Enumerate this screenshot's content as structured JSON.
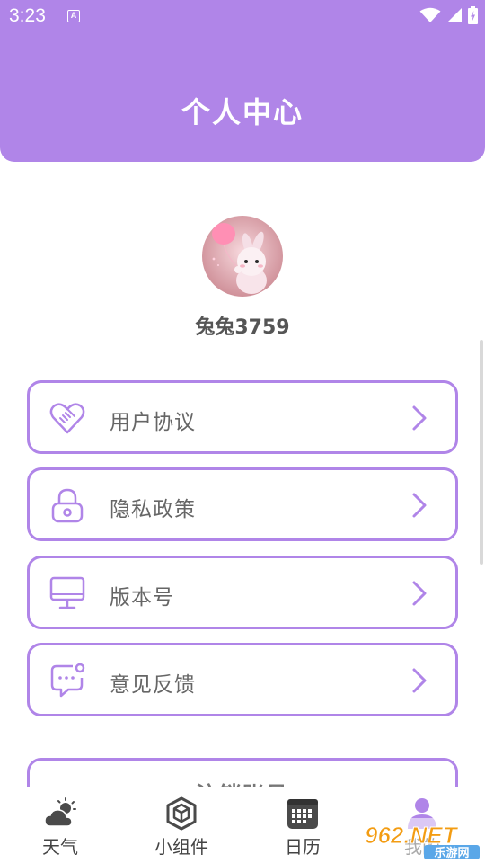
{
  "status_bar": {
    "time": "3:23",
    "notification_badge": "A",
    "icons": [
      "wifi-icon",
      "signal-icon",
      "battery-charging-icon"
    ]
  },
  "header": {
    "title": "个人中心"
  },
  "profile": {
    "avatar": "bunny-with-balloon-avatar",
    "username": "兔兔3759"
  },
  "menu": [
    {
      "icon": "handshake-heart-icon",
      "label": "用户协议"
    },
    {
      "icon": "lock-icon",
      "label": "隐私政策"
    },
    {
      "icon": "monitor-icon",
      "label": "版本号"
    },
    {
      "icon": "chat-bubble-icon",
      "label": "意见反馈"
    }
  ],
  "logout": {
    "label": "注销账号"
  },
  "bottom_nav": [
    {
      "icon": "weather-icon",
      "label": "天气"
    },
    {
      "icon": "widget-cube-icon",
      "label": "小组件"
    },
    {
      "icon": "calendar-icon",
      "label": "日历"
    },
    {
      "icon": "profile-icon",
      "label": "我的"
    }
  ],
  "watermark": {
    "text": "962.NET",
    "subtext": "乐游网"
  },
  "colors": {
    "accent": "#b085e8",
    "text": "#666666",
    "background": "#ffffff"
  }
}
